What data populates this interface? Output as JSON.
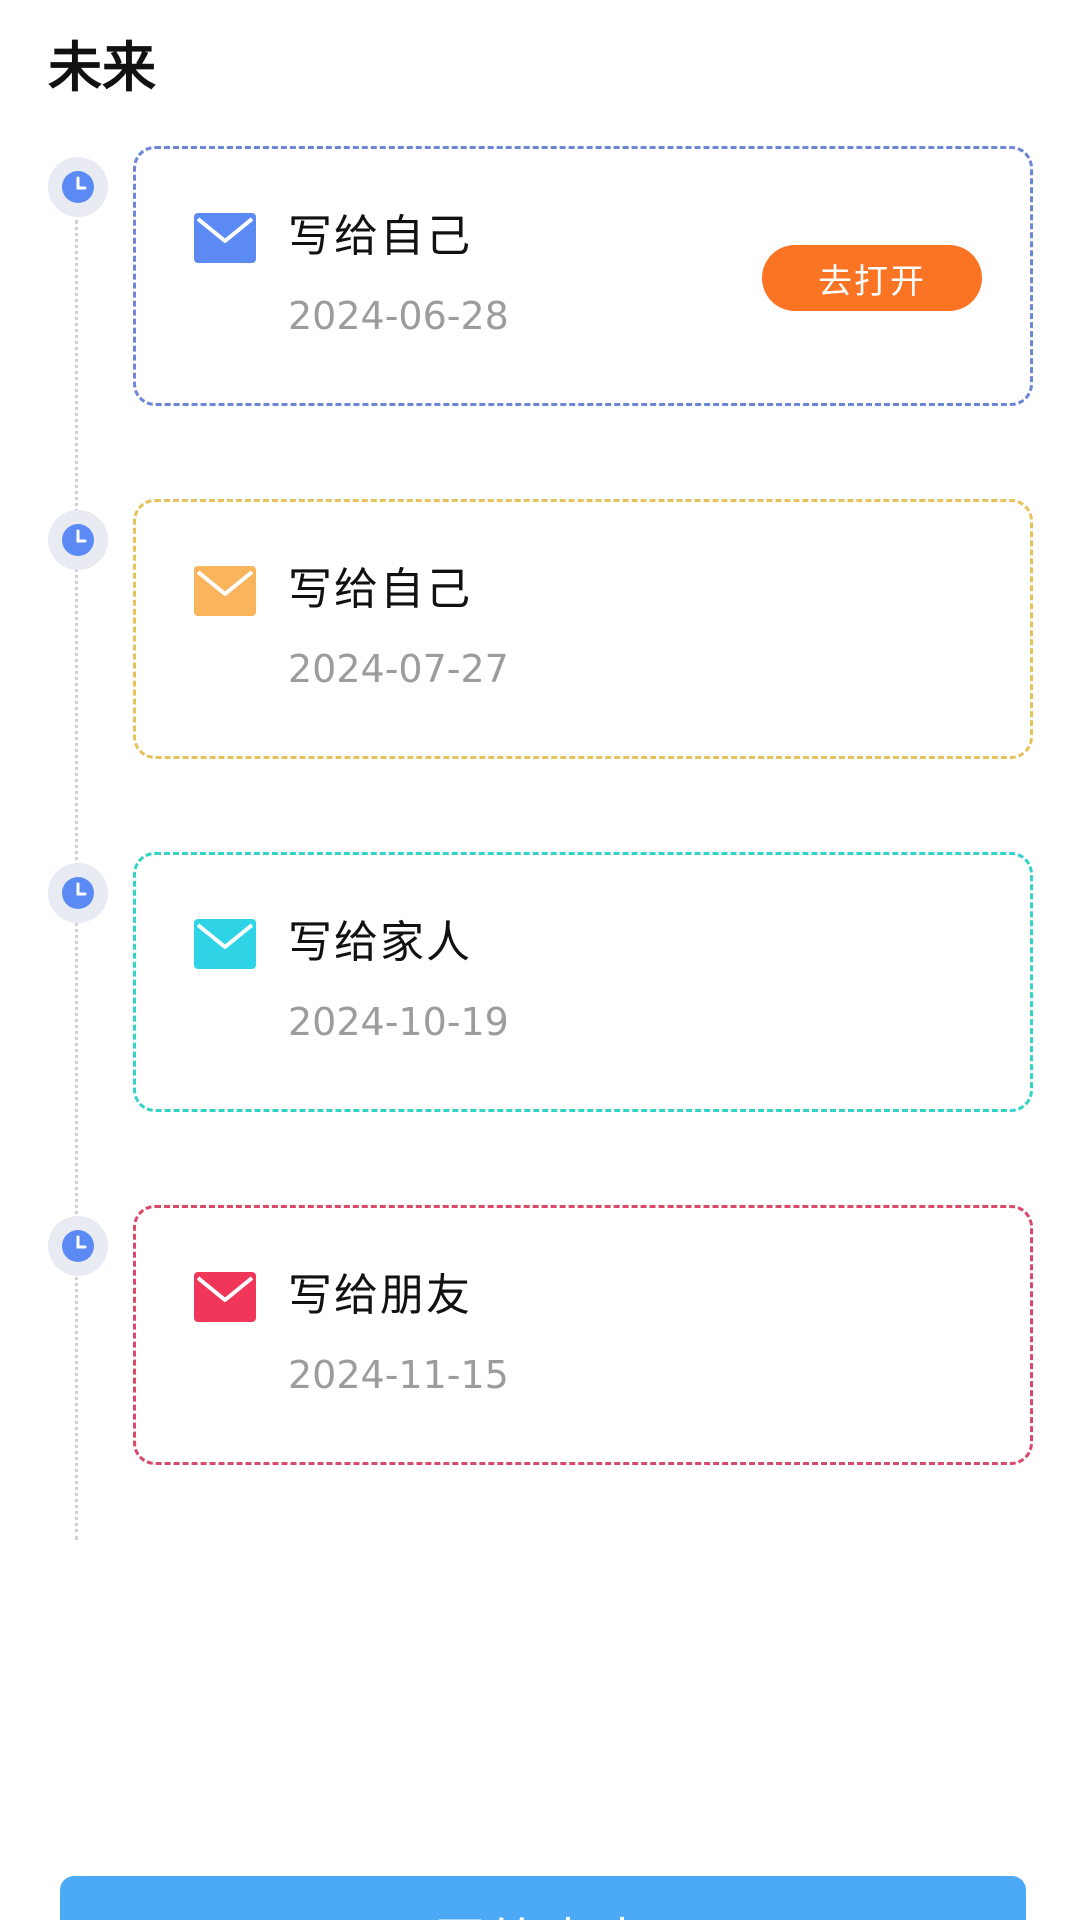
{
  "page": {
    "title": "未来"
  },
  "letters": [
    {
      "title": "写给自己",
      "date": "2024-06-28",
      "color": "#5b8af5",
      "border_color": "#6c86d8",
      "icon": "envelope-icon",
      "action_label": "去打开"
    },
    {
      "title": "写给自己",
      "date": "2024-07-27",
      "color": "#f9b45c",
      "border_color": "#e6c35a",
      "icon": "envelope-icon"
    },
    {
      "title": "写给家人",
      "date": "2024-10-19",
      "color": "#2ed3e6",
      "border_color": "#33d3c8",
      "icon": "envelope-icon"
    },
    {
      "title": "写给朋友",
      "date": "2024-11-15",
      "color": "#f0375a",
      "border_color": "#d94a6a",
      "icon": "envelope-icon"
    }
  ],
  "timeline": {
    "icon": "clock-icon",
    "icon_color": "#5b8af5"
  },
  "action_button": {
    "color": "#fb7424"
  },
  "bottom_button": {
    "label": "写给未来",
    "color": "#4ba9f5"
  }
}
